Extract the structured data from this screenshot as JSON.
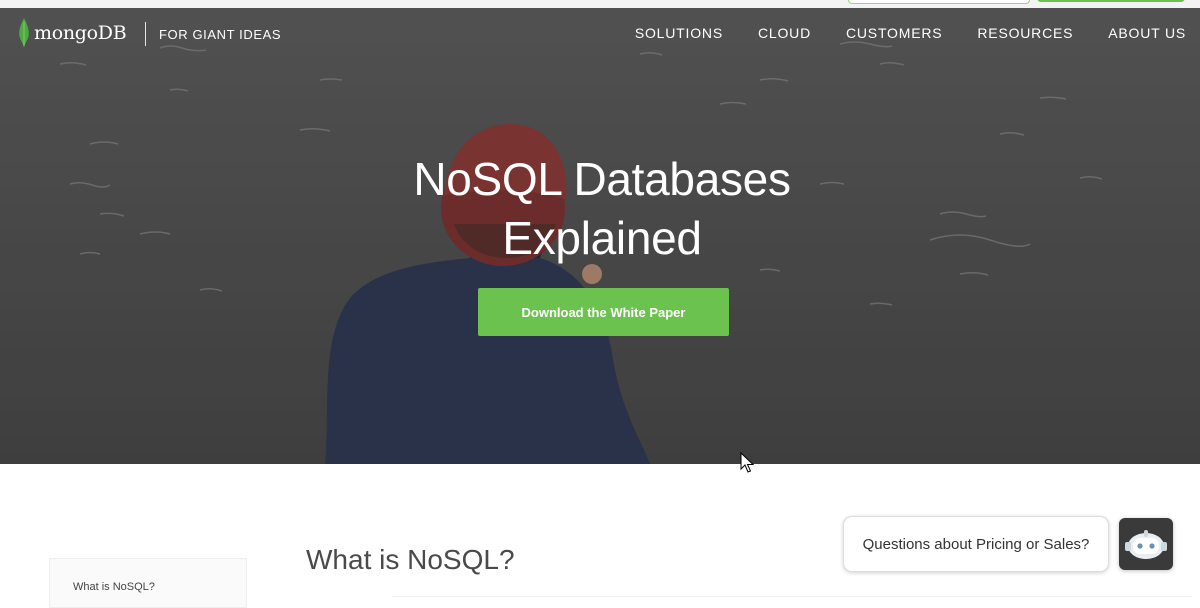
{
  "header": {
    "logo_text": "mongoDB",
    "tagline": "FOR GIANT IDEAS",
    "menu": [
      {
        "label": "SOLUTIONS"
      },
      {
        "label": "CLOUD"
      },
      {
        "label": "CUSTOMERS"
      },
      {
        "label": "RESOURCES"
      },
      {
        "label": "ABOUT US"
      }
    ]
  },
  "hero": {
    "title_line1": "NoSQL Databases",
    "title_line2": "Explained",
    "cta_label": "Download the White Paper"
  },
  "sidebar": {
    "items": [
      {
        "label": "What is NoSQL?"
      }
    ]
  },
  "content": {
    "section_title": "What is NoSQL?"
  },
  "chat": {
    "prompt": "Questions about Pricing or Sales?"
  },
  "colors": {
    "accent_green": "#6cc24e",
    "leaf_green": "#4faa41",
    "hero_gray": "#555555"
  },
  "icons": {
    "logo": "mongodb-leaf-icon",
    "chat_bot": "chat-bot-icon",
    "cursor": "mouse-cursor-icon"
  }
}
